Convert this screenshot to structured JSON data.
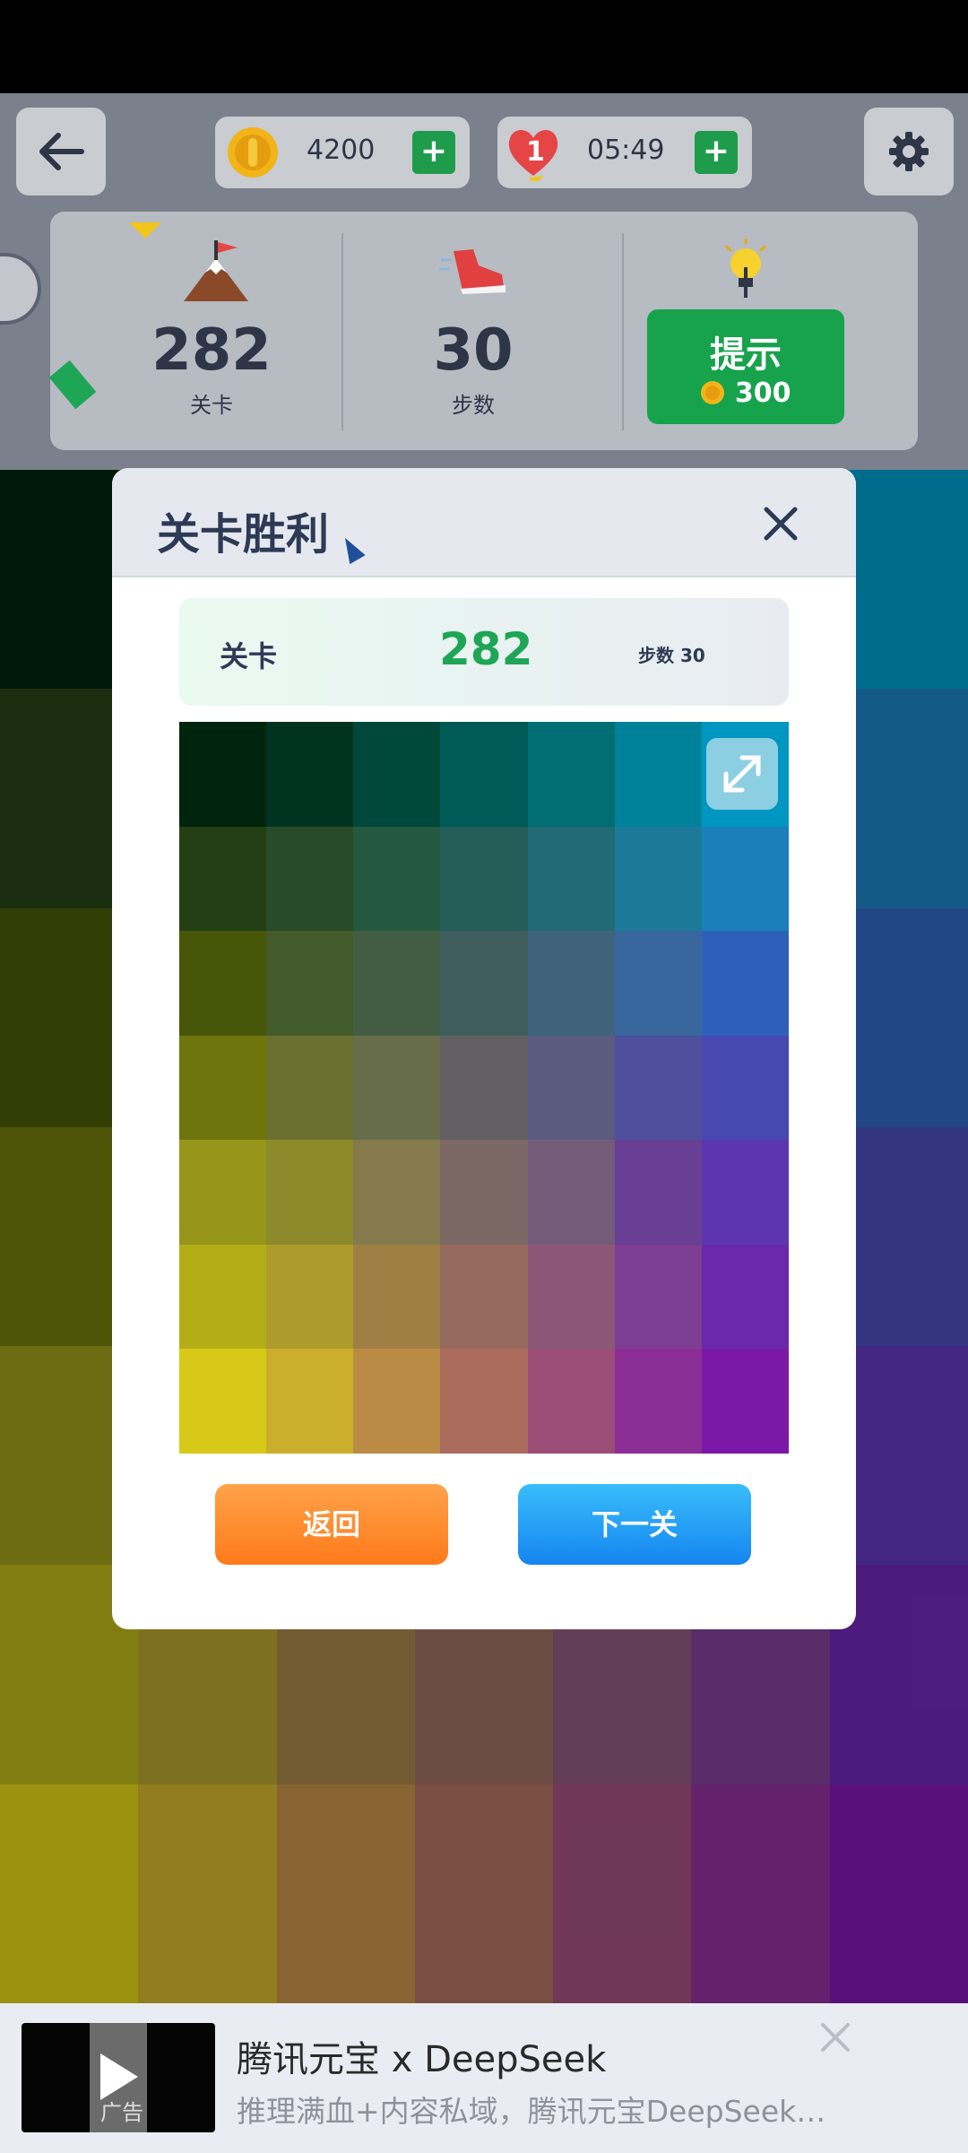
{
  "header": {
    "coins": "4200",
    "lives": "1",
    "timer": "05:49",
    "plus_symbol": "+"
  },
  "stats": {
    "level_value": "282",
    "level_label": "关卡",
    "steps_value": "30",
    "steps_label": "步数",
    "hint_label": "提示",
    "hint_cost": "300"
  },
  "dialog": {
    "title": "关卡胜利",
    "level_label": "关卡",
    "level_value": "282",
    "steps_text": "步数 30",
    "back_label": "返回",
    "next_label": "下一关"
  },
  "ad": {
    "title": "腾讯元宝 x DeepSeek",
    "description": "推理满血+内容私域，腾讯元宝DeepSeek…",
    "tag": "广告"
  },
  "colors": {
    "coin_gold": "#f2b519",
    "heart_red": "#e64545",
    "green_button": "#17a24c",
    "text_dark": "#2e3546",
    "orange_button": "#ff8a2a",
    "blue_button": "#1e9cf5"
  },
  "icons": [
    "back-arrow-icon",
    "coin-icon",
    "heart-icon",
    "gear-icon",
    "mountain-flag-icon",
    "sneaker-icon",
    "lightbulb-icon",
    "close-icon",
    "expand-icon",
    "play-icon"
  ],
  "board_colors": [
    [
      "#00250f",
      "#003420",
      "#00493a",
      "#005a55",
      "#006e73",
      "#00819a",
      "#0096c2"
    ],
    [
      "#243f14",
      "#284b2a",
      "#24583f",
      "#255d59",
      "#226a75",
      "#1c7a98",
      "#1b7fba"
    ],
    [
      "#475609",
      "#435b2a",
      "#425d44",
      "#3f5d5c",
      "#3e637a",
      "#3a669e",
      "#2d61b9"
    ],
    [
      "#6d750c",
      "#6a6f2f",
      "#676d4b",
      "#615f62",
      "#5a5b7e",
      "#4e4f9d",
      "#4748b0"
    ],
    [
      "#98961a",
      "#8c8a2b",
      "#847a4c",
      "#7b6864",
      "#745b7a",
      "#683f94",
      "#5d35b0"
    ],
    [
      "#b4ad18",
      "#ad9b2c",
      "#a07f45",
      "#976a5f",
      "#8b5678",
      "#7d3d93",
      "#6a28ac"
    ],
    [
      "#d8c918",
      "#cbae2c",
      "#bb8b46",
      "#ab6c5e",
      "#9b4d78",
      "#8b2e96",
      "#7c18a8"
    ]
  ]
}
